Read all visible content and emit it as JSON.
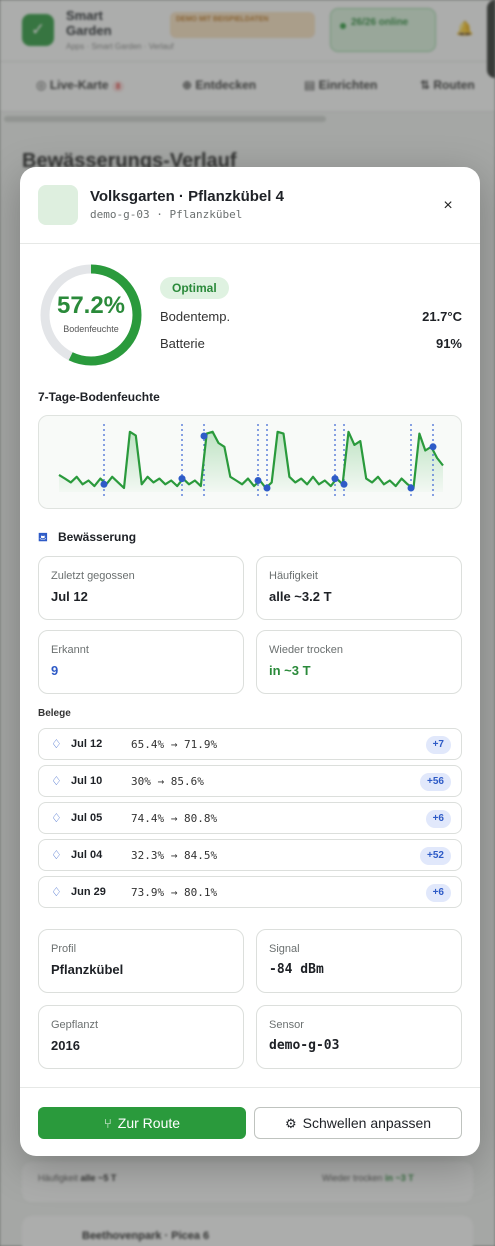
{
  "background": {
    "app_name": "Smart Garden",
    "breadcrumb": "Apps · Smart Garden · Verlauf",
    "demo_badge": "DEMO MIT BEISPIELDATEN",
    "online_status": "26/26 online",
    "nav": {
      "live": "Live-Karte",
      "live_count": "8",
      "discover": "Entdecken",
      "setup": "Einrichten",
      "route": "Routen"
    },
    "page_title": "Bewässerungs-Verlauf",
    "footer_row_freq_label": "Häufigkeit",
    "footer_row_freq_value": "alle ~5 T",
    "footer_row_dry_label": "Wieder trocken",
    "footer_row_dry_value": "in ~3 T",
    "next_card_title": "Beethovenpark · Picea 6"
  },
  "modal": {
    "title": "Volksgarten · Pflanzkübel 4",
    "subtitle": "demo-g-03 · Pflanzkübel",
    "close": "×",
    "moisture": {
      "value": "57.2%",
      "fraction": 0.572,
      "label": "Bodenfeuchte"
    },
    "status": "Optimal",
    "soil_temp": {
      "label": "Bodentemp.",
      "value": "21.7°C"
    },
    "battery": {
      "label": "Batterie",
      "value": "91%"
    },
    "chart_title": "7-Tage-Bodenfeuchte",
    "irrigation_title": "Bewässerung",
    "cards": {
      "last": {
        "label": "Zuletzt gegossen",
        "value": "Jul 12"
      },
      "frequency": {
        "label": "Häufigkeit",
        "value": "alle ~3.2 T"
      },
      "detected": {
        "label": "Erkannt",
        "value": "9"
      },
      "dry_again": {
        "label": "Wieder trocken",
        "value": "in ~3 T"
      }
    },
    "belege_title": "Belege",
    "belege": [
      {
        "date": "Jul 12",
        "range": "65.4% → 71.9%",
        "delta": "+7"
      },
      {
        "date": "Jul 10",
        "range": "30% → 85.6%",
        "delta": "+56"
      },
      {
        "date": "Jul 05",
        "range": "74.4% → 80.8%",
        "delta": "+6"
      },
      {
        "date": "Jul 04",
        "range": "32.3% → 84.5%",
        "delta": "+52"
      },
      {
        "date": "Jun 29",
        "range": "73.9% → 80.1%",
        "delta": "+6"
      }
    ],
    "details": {
      "profile": {
        "label": "Profil",
        "value": "Pflanzkübel"
      },
      "signal": {
        "label": "Signal",
        "value": "-84 dBm"
      },
      "planted": {
        "label": "Gepflanzt",
        "value": "2016"
      },
      "sensor": {
        "label": "Sensor",
        "value": "demo-g-03"
      }
    },
    "btn_route": "Zur Route",
    "btn_thresholds": "Schwellen anpassen"
  },
  "colors": {
    "accent_green": "#2a9a3c",
    "text_green": "#2a8a3a",
    "accent_blue": "#2e5bc7"
  },
  "chart_data": {
    "type": "area",
    "title": "7-Tage-Bodenfeuchte",
    "series": [
      {
        "values": [
          57,
          55,
          53,
          56,
          52,
          54,
          51,
          55,
          52,
          56,
          53,
          50,
          80,
          78,
          52,
          56,
          53,
          55,
          52,
          54,
          51,
          55,
          52,
          54,
          51,
          79,
          80,
          74,
          72,
          56,
          54,
          52,
          55,
          51,
          54,
          50,
          53,
          80,
          79,
          56,
          53,
          55,
          52,
          56,
          52,
          54,
          51,
          55,
          52,
          80,
          73,
          75,
          55,
          53,
          56,
          52,
          54,
          51,
          55,
          52,
          50,
          79,
          70,
          72,
          66,
          62
        ]
      }
    ],
    "events": [
      5,
      12.5,
      20.5,
      27,
      33
    ],
    "ylim": [
      0,
      100
    ]
  }
}
